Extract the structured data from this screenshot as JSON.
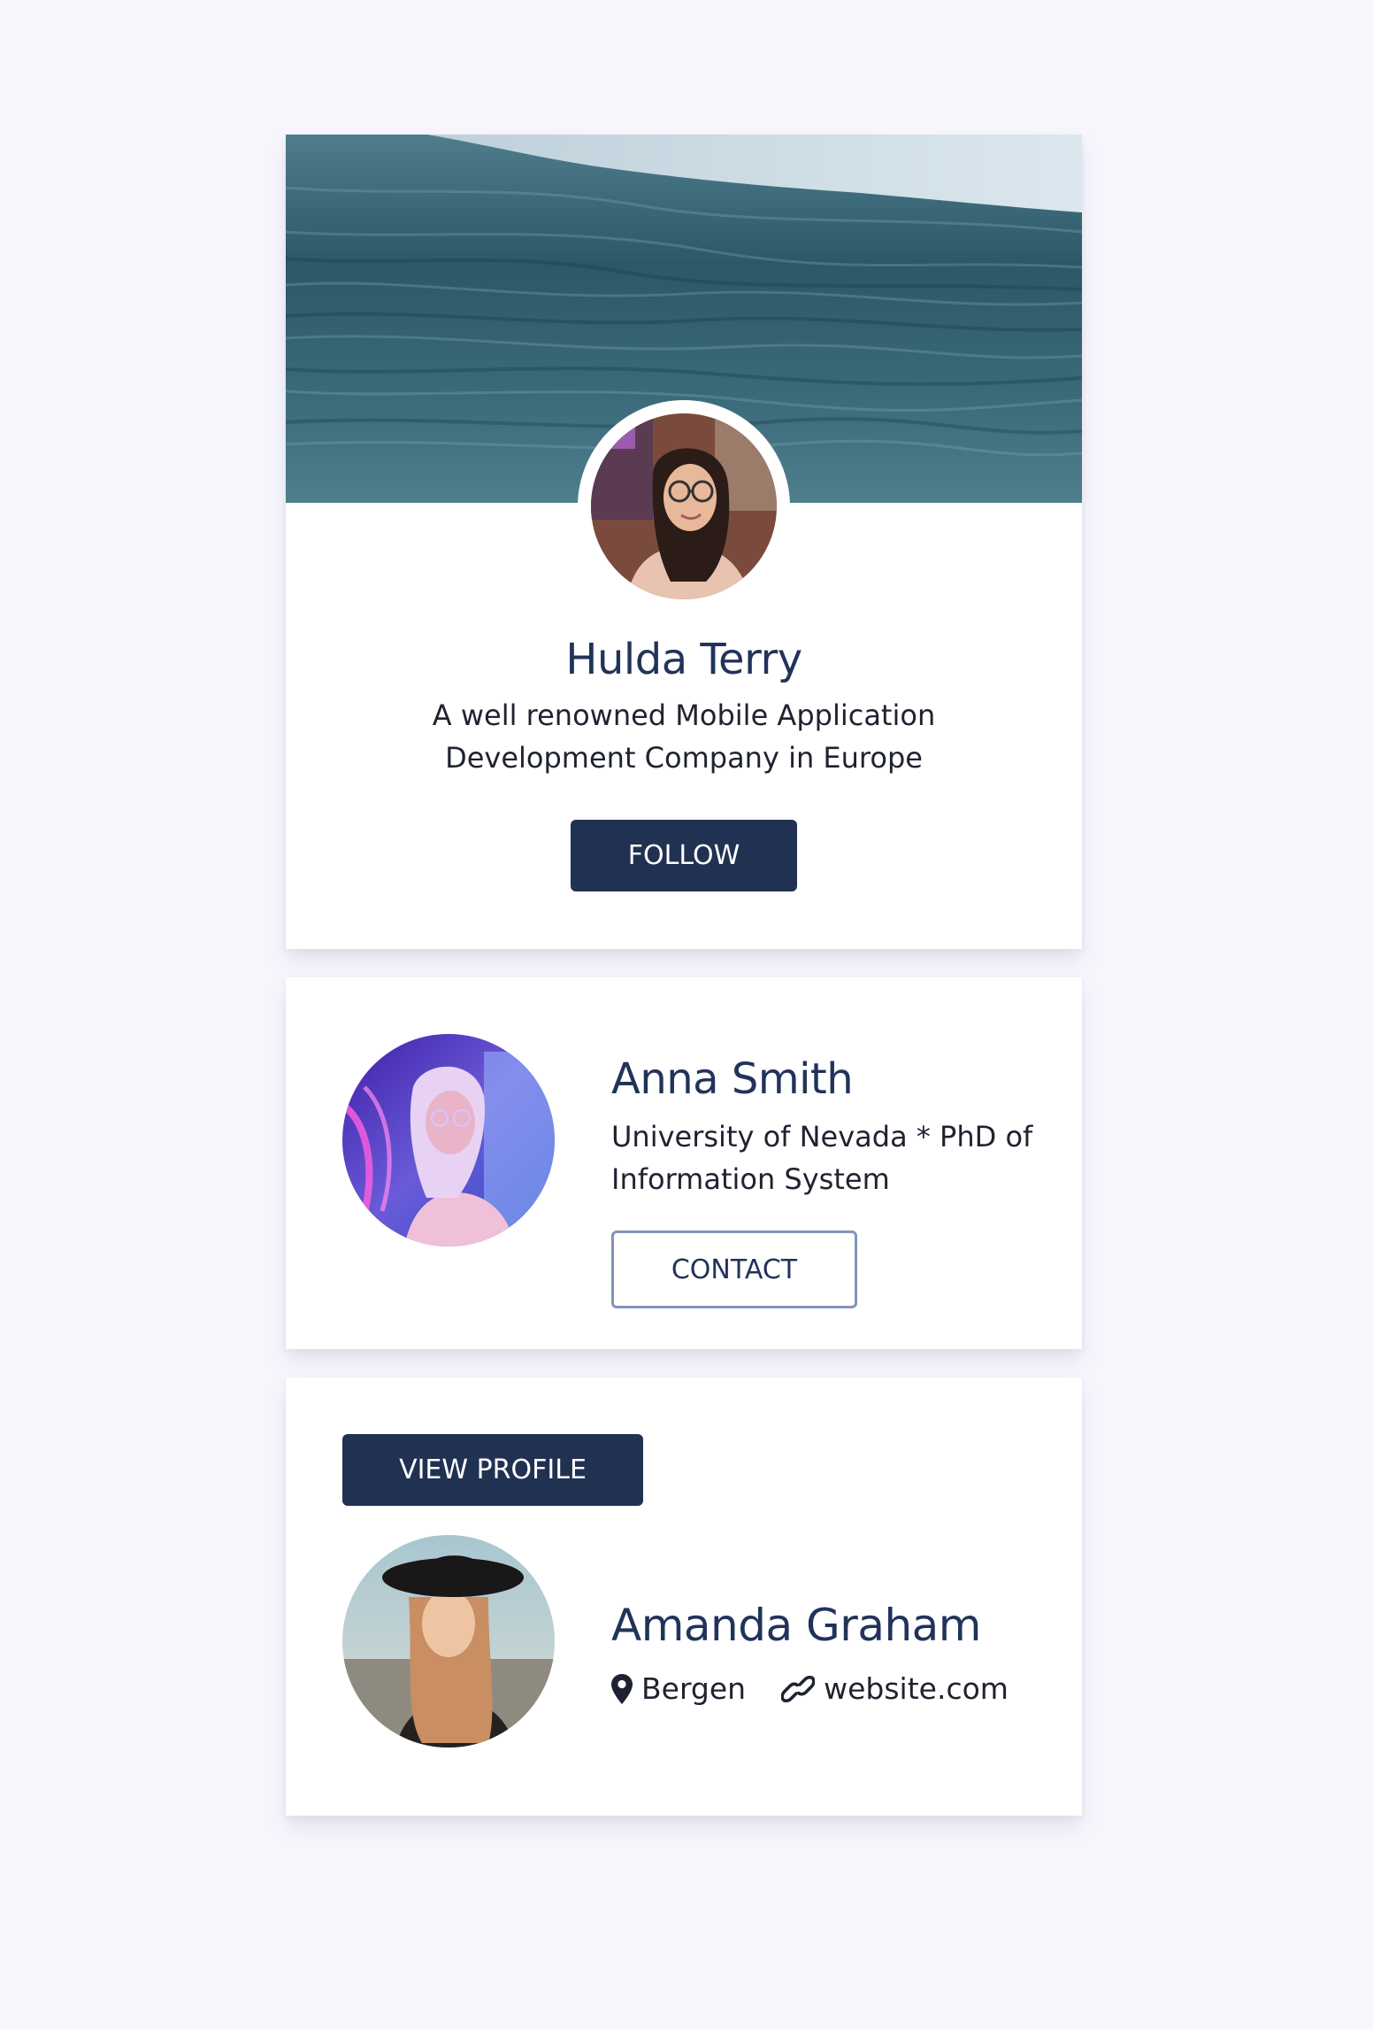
{
  "colors": {
    "page_background": "#f8f6fd",
    "card_background": "#ffffff",
    "primary": "#213152",
    "name_text": "#21335a",
    "body_text": "#1f2230",
    "outline_border": "#7f95bb"
  },
  "profile_card": {
    "cover_image": "ocean-waves-cover",
    "avatar": "woman-with-glasses-avatar",
    "name": "Hulda Terry",
    "description": "A well renowned Mobile Application Development Company in Europe",
    "follow_label": "FOLLOW"
  },
  "contact_card": {
    "photo": "woman-neon-light-portrait",
    "name": "Anna Smith",
    "description": "University of Nevada * PhD of Information System",
    "contact_label": "CONTACT"
  },
  "view_card": {
    "view_profile_label": "VIEW PROFILE",
    "photo": "woman-black-hat-portrait",
    "name": "Amanda Graham",
    "location_icon": "map-pin-icon",
    "location": "Bergen",
    "link_icon": "link-icon",
    "website": "website.com"
  }
}
